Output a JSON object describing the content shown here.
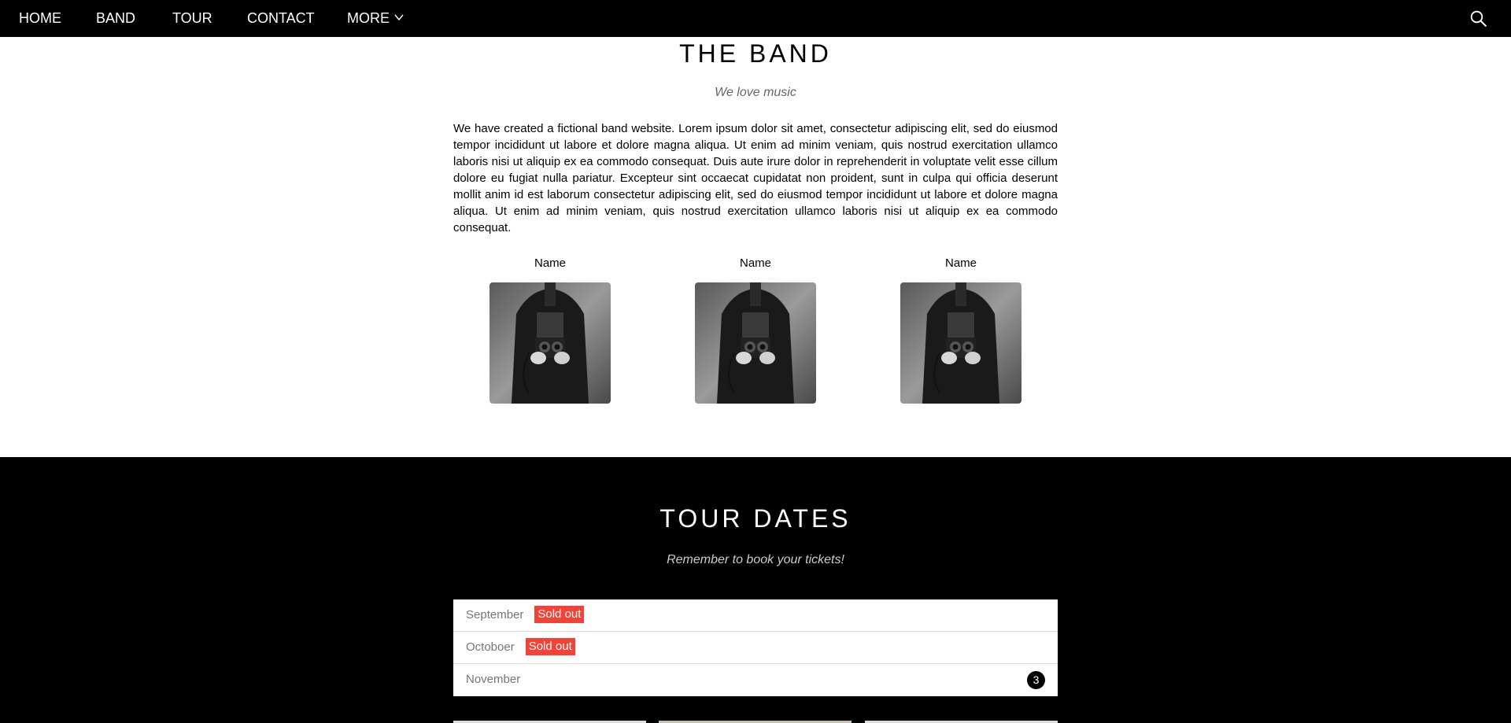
{
  "nav": {
    "items": [
      {
        "label": "HOME"
      },
      {
        "label": "BAND"
      },
      {
        "label": "TOUR"
      },
      {
        "label": "CONTACT"
      },
      {
        "label": "MORE"
      }
    ],
    "search_icon": "search-icon",
    "more_icon": "chevron-down-icon"
  },
  "band": {
    "title": "THE BAND",
    "subtitle": "We love music",
    "text": "We have created a fictional band website. Lorem ipsum dolor sit amet, consectetur adipiscing elit, sed do eiusmod tempor incididunt ut labore et dolore magna aliqua. Ut enim ad minim veniam, quis nostrud exercitation ullamco laboris nisi ut aliquip ex ea commodo consequat. Duis aute irure dolor in reprehenderit in voluptate velit esse cillum dolore eu fugiat nulla pariatur. Excepteur sint occaecat cupidatat non proident, sunt in culpa qui officia deserunt mollit anim id est laborum consectetur adipiscing elit, sed do eiusmod tempor incididunt ut labore et dolore magna aliqua. Ut enim ad minim veniam, quis nostrud exercitation ullamco laboris nisi ut aliquip ex ea commodo consequat.",
    "members": [
      {
        "name": "Name"
      },
      {
        "name": "Name"
      },
      {
        "name": "Name"
      }
    ]
  },
  "tour": {
    "title": "TOUR DATES",
    "subtitle": "Remember to book your tickets!",
    "months": [
      {
        "month": "September",
        "badge": "Sold out"
      },
      {
        "month": "Octoboer",
        "badge": "Sold out"
      },
      {
        "month": "November",
        "count": "3"
      }
    ]
  },
  "colors": {
    "nav_bg": "#000000",
    "sold_out": "#f44336",
    "tour_bg": "#000000"
  }
}
